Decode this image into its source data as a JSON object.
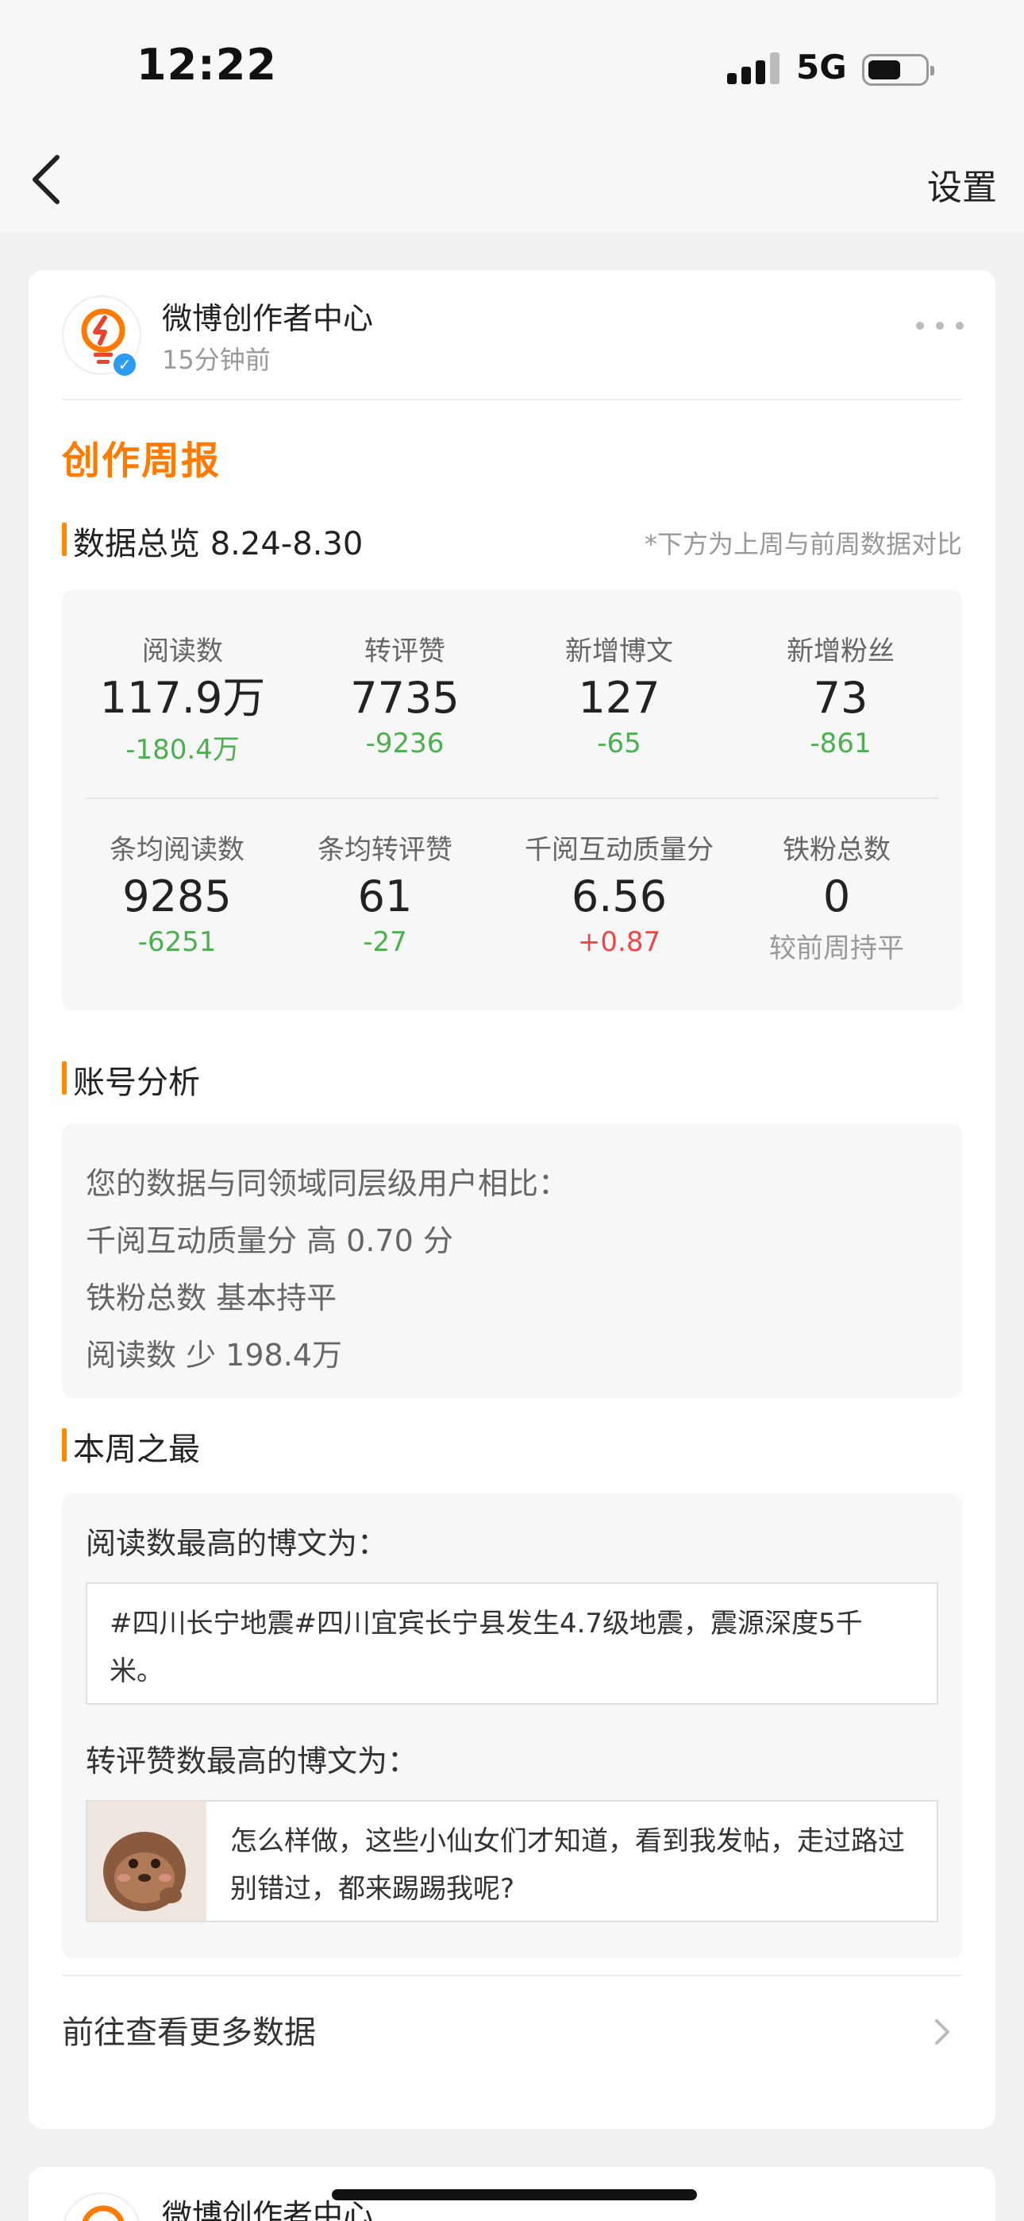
{
  "status_bar": {
    "time": "12:22",
    "network": "5G",
    "battery_percent": 45
  },
  "nav": {
    "settings_label": "设置"
  },
  "post": {
    "account_name": "微博创作者中心",
    "time_ago": "15分钟前",
    "report_title": "创作周报",
    "overview": {
      "title": "数据总览 8.24-8.30",
      "note": "*下方为上周与前周数据对比",
      "row1": [
        {
          "label": "阅读数",
          "value": "117.9万",
          "diff": "-180.4万",
          "trend": "down"
        },
        {
          "label": "转评赞",
          "value": "7735",
          "diff": "-9236",
          "trend": "down"
        },
        {
          "label": "新增博文",
          "value": "127",
          "diff": "-65",
          "trend": "down"
        },
        {
          "label": "新增粉丝",
          "value": "73",
          "diff": "-861",
          "trend": "down"
        }
      ],
      "row2": [
        {
          "label": "条均阅读数",
          "value": "9285",
          "diff": "-6251",
          "trend": "down"
        },
        {
          "label": "条均转评赞",
          "value": "61",
          "diff": "-27",
          "trend": "down"
        },
        {
          "label": "千阅互动质量分",
          "value": "6.56",
          "diff": "+0.87",
          "trend": "up"
        },
        {
          "label": "铁粉总数",
          "value": "0",
          "diff": "较前周持平",
          "trend": "flat"
        }
      ]
    },
    "analysis": {
      "title": "账号分析",
      "lines": [
        "您的数据与同领域同层级用户相比：",
        "千阅互动质量分 高 0.70 分",
        "铁粉总数 基本持平",
        "阅读数 少 198.4万"
      ]
    },
    "best": {
      "title": "本周之最",
      "top_read_label": "阅读数最高的博文为：",
      "top_read_text": "#四川长宁地震#四川宜宾长宁县发生4.7级地震，震源深度5千米。",
      "top_interact_label": "转评赞数最高的博文为：",
      "top_interact_text": "怎么样做，这些小仙女们才知道，看到我发帖，走过路过别错过，都来踢踢我呢?"
    },
    "more_data_label": "前往查看更多数据"
  },
  "next_post": {
    "account_name": "微博创作者中心"
  },
  "colors": {
    "accent": "#ff7a00",
    "bar": "#ff8a00",
    "down": "#4caf50",
    "up": "#e84a4a",
    "verified": "#2d9bf0"
  }
}
